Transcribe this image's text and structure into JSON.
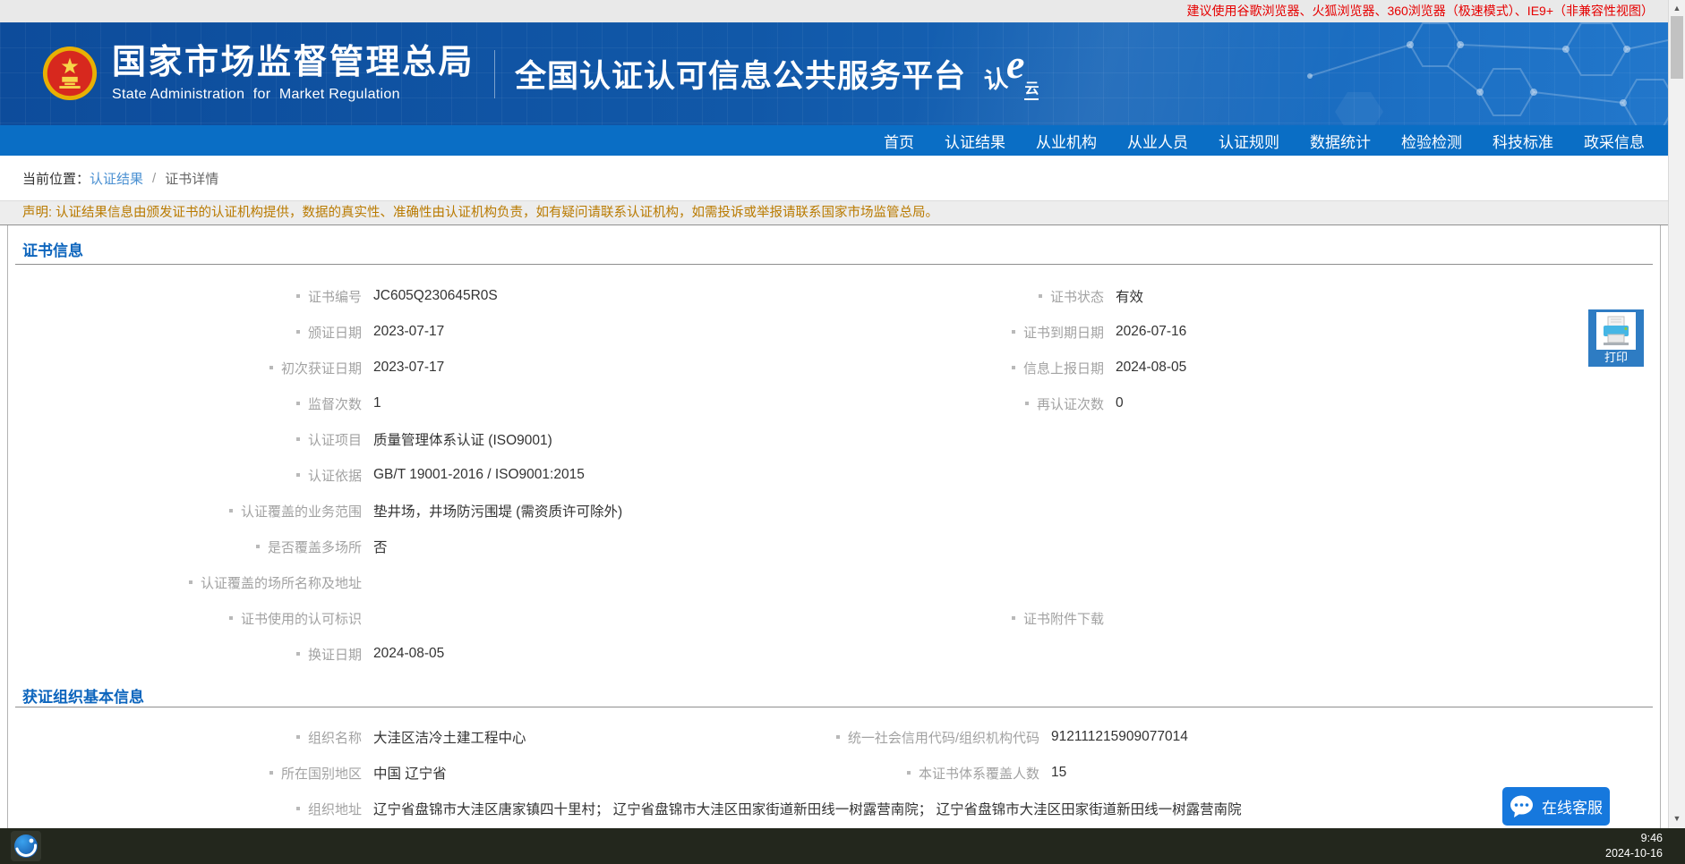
{
  "notice_bar": {
    "text": "建议使用谷歌浏览器、火狐浏览器、360浏览器（极速模式）、IE9+（非兼容性视图）"
  },
  "header": {
    "title_cn": "国家市场监督管理总局",
    "title_en": "State Administration  for  Market Regulation",
    "platform_title": "全国认证认可信息公共服务平台",
    "logo": {
      "ren": "认",
      "e": "e",
      "yun": "云"
    }
  },
  "nav": {
    "items": [
      "首页",
      "认证结果",
      "从业机构",
      "从业人员",
      "认证规则",
      "数据统计",
      "检验检测",
      "科技标准",
      "政采信息"
    ]
  },
  "breadcrumb": {
    "location_label": "当前位置：",
    "link": "认证结果",
    "separator": "/",
    "current": "证书详情"
  },
  "disclaimer": {
    "text": "声明: 认证结果信息由颁发证书的认证机构提供，数据的真实性、准确性由认证机构负责，如有疑问请联系认证机构，如需投诉或举报请联系国家市场监管总局。"
  },
  "cert_section": {
    "title": "证书信息",
    "print_button": {
      "label": "打印"
    },
    "left_fields": [
      {
        "row": 1,
        "label": "证书编号",
        "value": "JC605Q230645R0S"
      },
      {
        "row": 2,
        "label": "颁证日期",
        "value": "2023-07-17"
      },
      {
        "row": 3,
        "label": "初次获证日期",
        "value": "2023-07-17"
      },
      {
        "row": 4,
        "label": "监督次数",
        "value": "1"
      },
      {
        "row": 5,
        "label": "认证项目",
        "value": "质量管理体系认证 (ISO9001)"
      },
      {
        "row": 6,
        "label": "认证依据",
        "value": "GB/T 19001-2016 / ISO9001:2015"
      },
      {
        "row": 7,
        "label": "认证覆盖的业务范围",
        "value": "垫井场，井场防污围堤 (需资质许可除外)"
      },
      {
        "row": 8,
        "label": "是否覆盖多场所",
        "value": "否"
      },
      {
        "row": 9,
        "label": "认证覆盖的场所名称及地址",
        "value": ""
      },
      {
        "row": 10,
        "label": "证书使用的认可标识",
        "value": ""
      },
      {
        "row": 11,
        "label": "换证日期",
        "value": "2024-08-05"
      }
    ],
    "right_fields": [
      {
        "row": 1,
        "label": "证书状态",
        "value": "有效"
      },
      {
        "row": 2,
        "label": "证书到期日期",
        "value": "2026-07-16"
      },
      {
        "row": 3,
        "label": "信息上报日期",
        "value": "2024-08-05"
      },
      {
        "row": 4,
        "label": "再认证次数",
        "value": "0"
      },
      {
        "row": 10,
        "label": "证书附件下载",
        "value": ""
      }
    ]
  },
  "org_section": {
    "title": "获证组织基本信息",
    "left_fields": [
      {
        "row": 1,
        "label": "组织名称",
        "value": "大洼区洁冷土建工程中心"
      },
      {
        "row": 2,
        "label": "所在国别地区",
        "value": "中国 辽宁省"
      },
      {
        "row": 3,
        "label": "组织地址",
        "value": "辽宁省盘锦市大洼区唐家镇四十里村； 辽宁省盘锦市大洼区田家街道新田线一树露营南院； 辽宁省盘锦市大洼区田家街道新田线一树露营南院"
      }
    ],
    "right_fields": [
      {
        "row": 1,
        "label": "统一社会信用代码/组织机构代码",
        "value": "912111215909077014"
      },
      {
        "row": 2,
        "label": "本证书体系覆盖人数",
        "value": "15"
      }
    ]
  },
  "chat_button": {
    "label": "在线客服"
  },
  "taskbar": {
    "time": "9:46",
    "date": "2024-10-16"
  },
  "icons": {
    "scroll_up_icon": "▲",
    "scroll_down_icon": "▼",
    "bullet_icon": "▪",
    "printer_icon": "printer",
    "chat_bubble_icon": "speech-bubble-with-dots",
    "national_emblem_icon": "china-national-emblem",
    "browser_icon": "blue-browser-globe"
  },
  "colors": {
    "header_blue": "#1158a8",
    "nav_blue": "#0a6ec5",
    "section_title_blue": "#0d65bd",
    "link_blue": "#4a90d2",
    "notice_red": "#e60000",
    "disclaimer_orange": "#b97a00",
    "label_gray": "#a2a2a2",
    "value_dark": "#333333",
    "chat_blue": "#1678dd",
    "print_button_blue": "#2e7cc3",
    "taskbar_dark": "#23271d"
  }
}
